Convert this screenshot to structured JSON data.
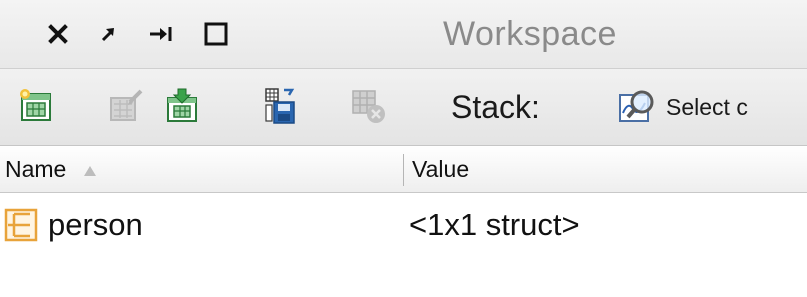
{
  "window": {
    "title": "Workspace",
    "controls": [
      "close",
      "undock",
      "minimize",
      "maximize"
    ]
  },
  "toolbar": {
    "buttons": [
      {
        "icon": "new-variable-icon",
        "enabled": true
      },
      {
        "icon": "open-variable-icon",
        "enabled": false
      },
      {
        "icon": "import-data-icon",
        "enabled": true
      },
      {
        "icon": "save-workspace-icon",
        "enabled": true
      },
      {
        "icon": "delete-variable-icon",
        "enabled": false
      }
    ],
    "stack_label": "Stack:",
    "select_label": "Select c"
  },
  "table": {
    "columns": [
      {
        "label": "Name",
        "sorted": "ascending"
      },
      {
        "label": "Value"
      }
    ],
    "rows": [
      {
        "name": "person",
        "value": "<1x1 struct>",
        "icon": "struct-icon"
      }
    ]
  },
  "colors": {
    "title_text": "#8a8a8a",
    "struct_icon": "#e8a33a",
    "toolbar_bg": "#e8e8e8"
  }
}
